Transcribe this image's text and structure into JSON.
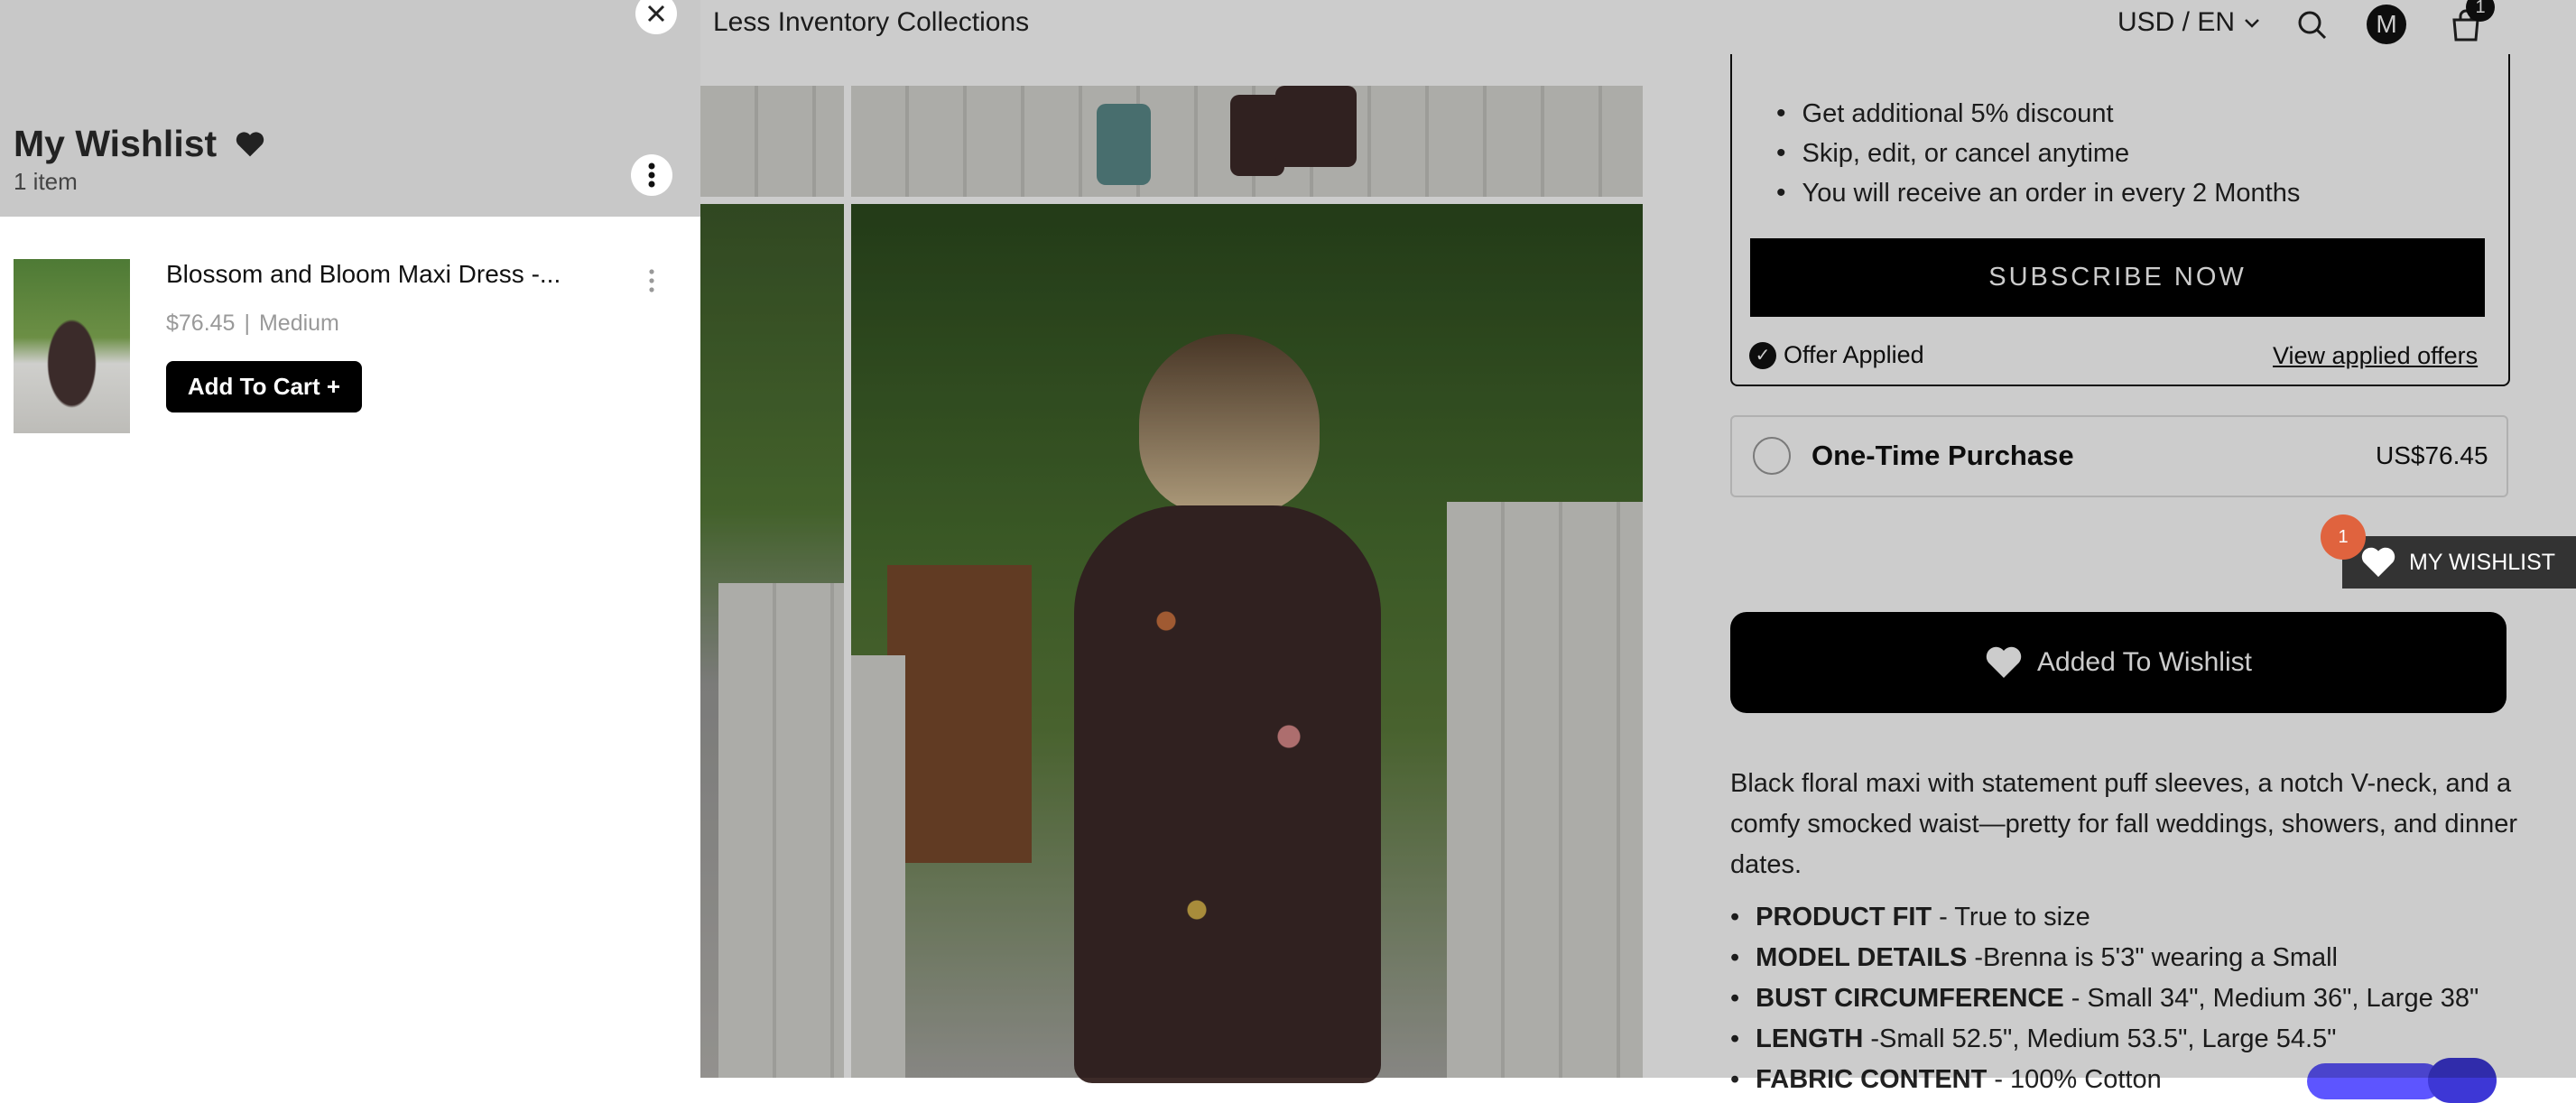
{
  "header": {
    "store_name": "Less Inventory Collections",
    "currency": "USD / EN",
    "avatar_letter": "M",
    "cart_count": "1"
  },
  "subscription": {
    "bullets": [
      "Get additional 5% discount",
      "Skip, edit, or cancel anytime",
      "You will receive an order in every 2 Months"
    ],
    "subscribe_label": "SUBSCRIBE NOW",
    "offer_applied": "Offer Applied",
    "view_offers": "View applied offers"
  },
  "one_time": {
    "label": "One-Time Purchase",
    "price": "US$76.45"
  },
  "wishlist_button": "Added To Wishlist",
  "description": "Black floral maxi with statement puff sleeves, a notch V-neck, and a comfy smocked waist—pretty for fall weddings, showers, and dinner dates.",
  "specs": [
    {
      "key": "PRODUCT FIT",
      "value": "- True to size"
    },
    {
      "key": "MODEL DETAILS",
      "value": "-Brenna is 5'3\" wearing a Small"
    },
    {
      "key": "BUST CIRCUMFERENCE",
      "value": "- Small 34\", Medium 36\", Large 38\""
    },
    {
      "key": "LENGTH",
      "value": "-Small 52.5\", Medium 53.5\", Large 54.5\""
    },
    {
      "key": "FABRIC CONTENT",
      "value": "- 100% Cotton"
    }
  ],
  "floating_tab": {
    "label": "MY WISHLIST",
    "count": "1"
  },
  "drawer": {
    "title": "My Wishlist",
    "count": "1 item",
    "items": [
      {
        "name": "Blossom and Bloom Maxi Dress -...",
        "price": "$76.45",
        "variant": "Medium",
        "add_label": "Add To Cart +"
      }
    ]
  },
  "colors": {
    "accent": "#000000",
    "badge": "#e0633e",
    "drawer_header": "#c8c8c8"
  }
}
